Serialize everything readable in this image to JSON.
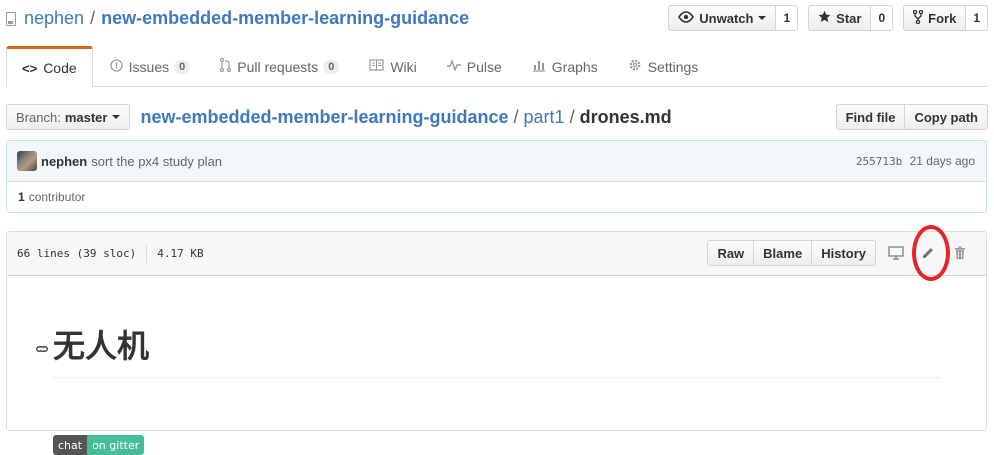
{
  "repo": {
    "owner": "nephen",
    "separator": "/",
    "name": "new-embedded-member-learning-guidance"
  },
  "actions": {
    "watch_label": "Unwatch",
    "watch_count": "1",
    "star_label": "Star",
    "star_count": "0",
    "fork_label": "Fork",
    "fork_count": "1"
  },
  "tabs": [
    {
      "label": "Code",
      "icon": "code-icon",
      "selected": true
    },
    {
      "label": "Issues",
      "icon": "issue-icon",
      "count": "0"
    },
    {
      "label": "Pull requests",
      "icon": "pull-request-icon",
      "count": "0"
    },
    {
      "label": "Wiki",
      "icon": "book-icon"
    },
    {
      "label": "Pulse",
      "icon": "pulse-icon"
    },
    {
      "label": "Graphs",
      "icon": "graph-icon"
    },
    {
      "label": "Settings",
      "icon": "gear-icon"
    }
  ],
  "file_nav": {
    "branch_label": "Branch:",
    "branch_value": "master",
    "breadcrumb_root": "new-embedded-member-learning-guidance",
    "sep": "/",
    "breadcrumb_dir": "part1",
    "breadcrumb_file": "drones.md",
    "find_file": "Find file",
    "copy_path": "Copy path"
  },
  "commit": {
    "author": "nephen",
    "message": "sort the px4 study plan",
    "sha": "255713b",
    "time": "21 days ago"
  },
  "contributors": {
    "count": "1",
    "label": "contributor"
  },
  "file": {
    "lines": "66 lines (39 sloc)",
    "size": "4.17 KB",
    "raw": "Raw",
    "blame": "Blame",
    "history": "History"
  },
  "readme": {
    "heading": "无人机",
    "badge_left": "chat",
    "badge_right": "on gitter"
  },
  "colors": {
    "link": "#4078c0",
    "tab_accent": "#d26911",
    "highlight_ring": "#e4252b",
    "badge_right": "#46bc99"
  }
}
